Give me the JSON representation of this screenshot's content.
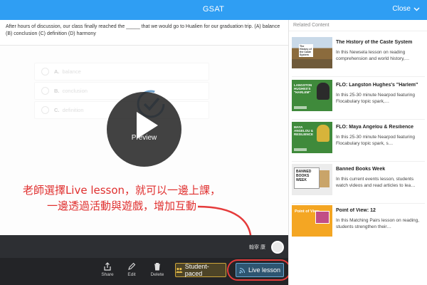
{
  "header": {
    "title": "GSAT",
    "close_label": "Close"
  },
  "question": {
    "text": "After hours of discussion, our class finally reached the _____ that we would go to Hualien for our graduation trip. (A) balance (B) conclusion (C) definition (D) harmony"
  },
  "answers": [
    {
      "letter": "A.",
      "text": "balance"
    },
    {
      "letter": "B.",
      "text": "conclusion"
    },
    {
      "letter": "C.",
      "text": "definition"
    }
  ],
  "preview": {
    "label": "Preview"
  },
  "annotation": {
    "line1": "老師選擇Live lesson，就可以一邊上課，",
    "line2": "一邊透過活動與遊戲，增加互動"
  },
  "user": {
    "name": "翰寧 康"
  },
  "toolbar": {
    "share_label": "Share",
    "edit_label": "Edit",
    "delete_label": "Delete",
    "student_paced_label": "Student-paced",
    "live_lesson_label": "Live lesson"
  },
  "related": {
    "heading": "Related Content",
    "items": [
      {
        "title": "The History of the Caste System",
        "desc": "In this Newsela lesson on reading comprehension and world history,…",
        "thumb_text": "The History of the Caste System"
      },
      {
        "title": "FLO: Langston Hughes's \"Harlem\"",
        "desc": "In this 25-30 minute Nearpod featuring Flocabulary topic spark,…",
        "thumb_text": "LANGSTON HUGHES'S \"HARLEM\""
      },
      {
        "title": "FLO: Maya Angelou & Resilience",
        "desc": "In this 25-30 minute Nearpod featuring Flocabulary topic spark, s…",
        "thumb_text": "MAYA ANGELOU & RESILIENCE"
      },
      {
        "title": "Banned Books Week",
        "desc": "In this current events lesson, students watch videos and read articles to lea…",
        "thumb_text": "BANNED BOOKS WEEK"
      },
      {
        "title": "Point of View: 12",
        "desc": "In this Matching Pairs lesson on reading, students strengthen their…",
        "thumb_text": "Point of View"
      }
    ]
  },
  "colors": {
    "header_blue": "#2f9ef3",
    "annotation_red": "#e0302f",
    "toolbar_dark": "#232427",
    "student_paced_gold": "#cfa63a",
    "live_lesson_blue": "#2e5570"
  }
}
